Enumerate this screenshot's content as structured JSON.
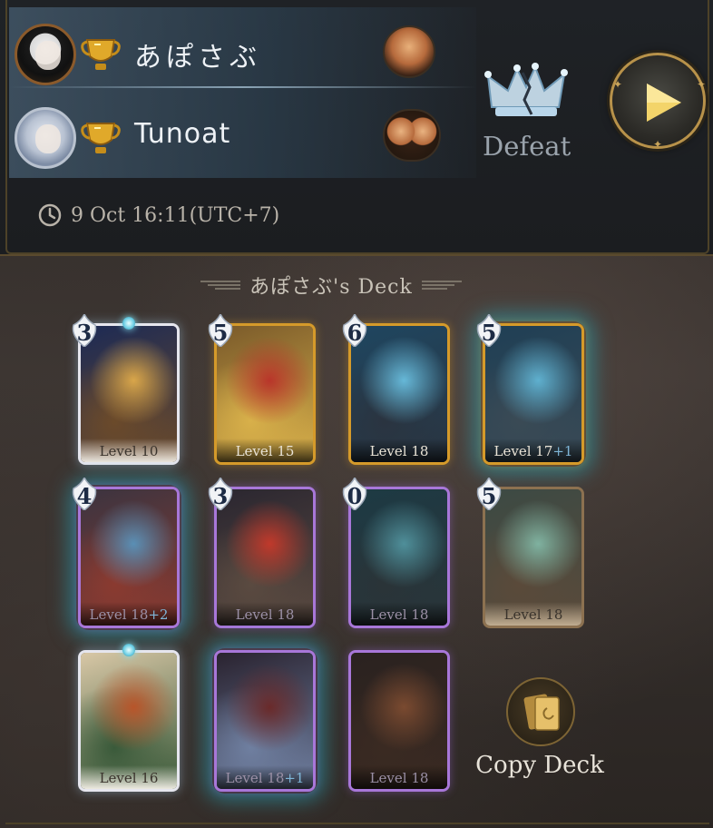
{
  "match": {
    "result": "Defeat",
    "timestamp": "9 Oct 16:11(UTC+7)"
  },
  "players": [
    {
      "name": "あぽさぶ",
      "avatar": "dark-haired-avatar",
      "trophy_icon": "gold-trophy-icon",
      "hero": "hero-portrait-glasses"
    },
    {
      "name": "Tunoat",
      "avatar": "silver-haired-avatar",
      "trophy_icon": "gold-trophy-icon",
      "hero": "hero-portrait-twins"
    }
  ],
  "deck": {
    "title": "あぽさぶ's Deck",
    "copy_label": "Copy Deck",
    "cards": [
      {
        "cost": "3",
        "level": "Level 10",
        "bonus": "",
        "frame": "white",
        "gem": true,
        "aura": false,
        "art": [
          "#1c2a55",
          "#d9a64a",
          "#6b4a2a"
        ]
      },
      {
        "cost": "5",
        "level": "Level 15",
        "bonus": "",
        "frame": "orange",
        "gem": false,
        "aura": false,
        "art": [
          "#7a5a2a",
          "#b9352a",
          "#d8b04a"
        ]
      },
      {
        "cost": "6",
        "level": "Level 18",
        "bonus": "",
        "frame": "orange",
        "gem": false,
        "aura": false,
        "art": [
          "#1f4660",
          "#66b8d8",
          "#2a3440"
        ]
      },
      {
        "cost": "5",
        "level": "Level 17",
        "bonus": "+1",
        "frame": "orange",
        "gem": false,
        "aura": true,
        "art": [
          "#1f3f55",
          "#5fb0cf",
          "#3a4a55"
        ]
      },
      {
        "cost": "4",
        "level": "Level 18",
        "bonus": "+2",
        "frame": "purple",
        "gem": false,
        "aura": true,
        "art": [
          "#3b3440",
          "#5a8fb5",
          "#8a3a30"
        ]
      },
      {
        "cost": "3",
        "level": "Level 18",
        "bonus": "",
        "frame": "purple",
        "gem": false,
        "aura": false,
        "art": [
          "#2a2630",
          "#c0392b",
          "#5a4a40"
        ]
      },
      {
        "cost": "0",
        "level": "Level 18",
        "bonus": "",
        "frame": "purple",
        "gem": false,
        "aura": false,
        "art": [
          "#1d3a44",
          "#4f8f9a",
          "#2a3438"
        ]
      },
      {
        "cost": "5",
        "level": "Level 18",
        "bonus": "",
        "frame": "parch",
        "gem": false,
        "aura": false,
        "art": [
          "#3c4a44",
          "#7fb2a0",
          "#5a4a3a"
        ]
      },
      {
        "cost": "",
        "level": "Level 16",
        "bonus": "",
        "frame": "white",
        "gem": true,
        "aura": false,
        "art": [
          "#d8c7a6",
          "#b8552a",
          "#3a5a3a"
        ]
      },
      {
        "cost": "",
        "level": "Level 18",
        "bonus": "+1",
        "frame": "purple",
        "gem": false,
        "aura": true,
        "art": [
          "#2a2330",
          "#6a2a2a",
          "#6f7fa0"
        ]
      },
      {
        "cost": "",
        "level": "Level 18",
        "bonus": "",
        "frame": "purple",
        "gem": false,
        "aura": false,
        "art": [
          "#2a2220",
          "#7a4a30",
          "#3a2a22"
        ]
      }
    ]
  },
  "icons": {
    "clock": "clock-icon",
    "crown": "broken-crown-icon",
    "play": "play-icon",
    "copy": "copy-deck-icon"
  },
  "colors": {
    "accent_gold": "#c9a45a",
    "play_arrow": "#f3d46a",
    "defeat_text": "#9aa3ac"
  }
}
